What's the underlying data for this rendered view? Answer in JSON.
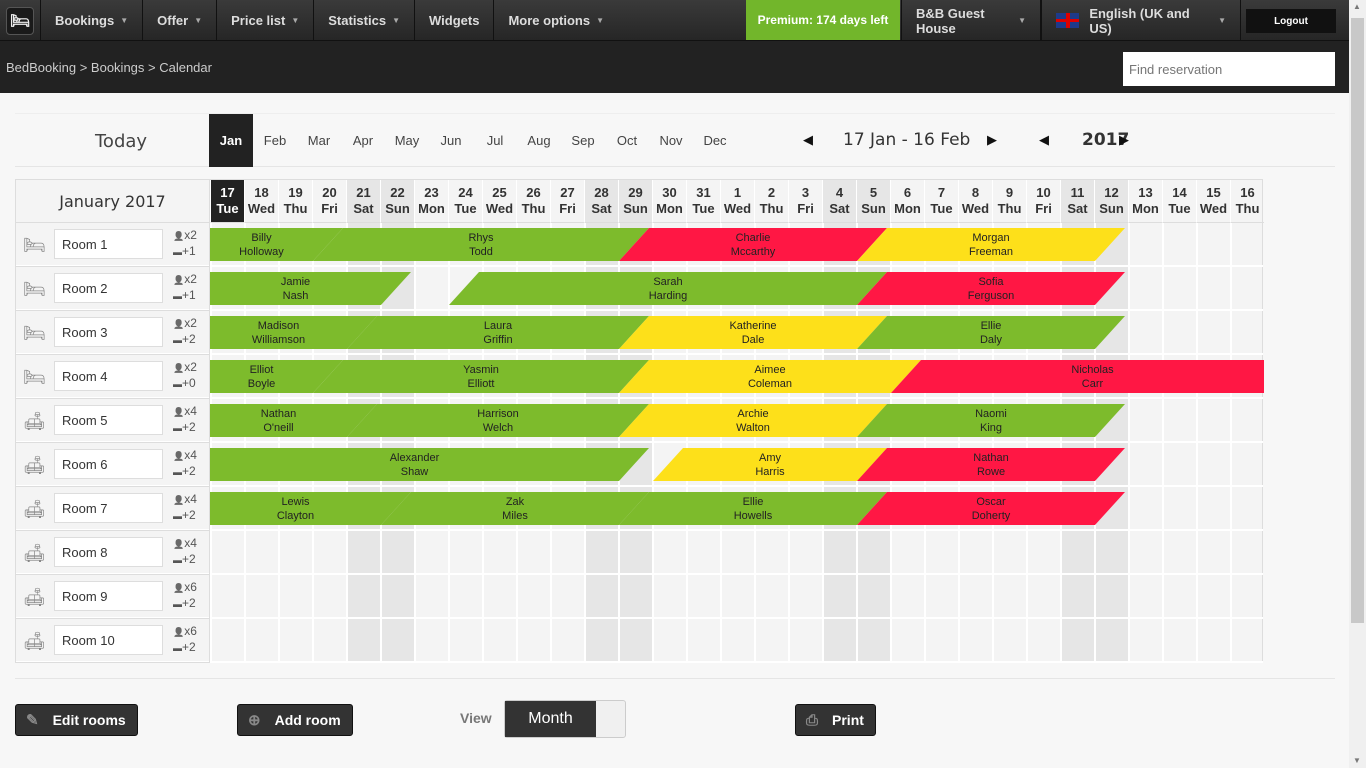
{
  "nav": {
    "items": [
      {
        "label": "Bookings",
        "dropdown": true
      },
      {
        "label": "Offer",
        "dropdown": true
      },
      {
        "label": "Price list",
        "dropdown": true
      },
      {
        "label": "Statistics",
        "dropdown": true
      },
      {
        "label": "Widgets",
        "dropdown": false
      },
      {
        "label": "More options",
        "dropdown": true
      }
    ],
    "premium": "Premium: 174 days left",
    "property": "B&B Guest House",
    "language": "English (UK and US)",
    "logout": "Logout"
  },
  "breadcrumb": "BedBooking > Bookings > Calendar",
  "search": {
    "placeholder": "Find reservation",
    "value": ""
  },
  "toolbar": {
    "today": "Today",
    "months": [
      "Jan",
      "Feb",
      "Mar",
      "Apr",
      "May",
      "Jun",
      "Jul",
      "Aug",
      "Sep",
      "Oct",
      "Nov",
      "Dec"
    ],
    "active_month": "Jan",
    "range": "17 Jan - 16 Feb",
    "year": "2017"
  },
  "calendar": {
    "title": "January 2017",
    "today_index": 0,
    "days": [
      [
        "17",
        "Tue"
      ],
      [
        "18",
        "Wed"
      ],
      [
        "19",
        "Thu"
      ],
      [
        "20",
        "Fri"
      ],
      [
        "21",
        "Sat"
      ],
      [
        "22",
        "Sun"
      ],
      [
        "23",
        "Mon"
      ],
      [
        "24",
        "Tue"
      ],
      [
        "25",
        "Wed"
      ],
      [
        "26",
        "Thu"
      ],
      [
        "27",
        "Fri"
      ],
      [
        "28",
        "Sat"
      ],
      [
        "29",
        "Sun"
      ],
      [
        "30",
        "Mon"
      ],
      [
        "31",
        "Tue"
      ],
      [
        "1",
        "Wed"
      ],
      [
        "2",
        "Thu"
      ],
      [
        "3",
        "Fri"
      ],
      [
        "4",
        "Sat"
      ],
      [
        "5",
        "Sun"
      ],
      [
        "6",
        "Mon"
      ],
      [
        "7",
        "Tue"
      ],
      [
        "8",
        "Wed"
      ],
      [
        "9",
        "Thu"
      ],
      [
        "10",
        "Fri"
      ],
      [
        "11",
        "Sat"
      ],
      [
        "12",
        "Sun"
      ],
      [
        "13",
        "Mon"
      ],
      [
        "14",
        "Tue"
      ],
      [
        "15",
        "Wed"
      ],
      [
        "16",
        "Thu"
      ]
    ],
    "colors": {
      "green": "#7dbb2c",
      "yellow": "#fde01a",
      "red": "#ff1744"
    },
    "rooms": [
      {
        "name": "Room 1",
        "icon": "single-bed",
        "guests": "x2",
        "extra": "+1",
        "bookings": [
          {
            "first": "Billy",
            "last": "Holloway",
            "in": null,
            "out": "2017-01-20",
            "color": "green"
          },
          {
            "first": "Rhys",
            "last": "Todd",
            "in": "2017-01-20",
            "out": "2017-01-29",
            "color": "green"
          },
          {
            "first": "Charlie",
            "last": "Mccarthy",
            "in": "2017-01-29",
            "out": "2017-02-05",
            "color": "red"
          },
          {
            "first": "Morgan",
            "last": "Freeman",
            "in": "2017-02-05",
            "out": "2017-02-12",
            "color": "yellow"
          }
        ]
      },
      {
        "name": "Room 2",
        "icon": "single-bed",
        "guests": "x2",
        "extra": "+1",
        "bookings": [
          {
            "first": "Jamie",
            "last": "Nash",
            "in": null,
            "out": "2017-01-22",
            "color": "green"
          },
          {
            "first": "Sarah",
            "last": "Harding",
            "in": "2017-01-24",
            "out": "2017-02-05",
            "color": "green"
          },
          {
            "first": "Sofia",
            "last": "Ferguson",
            "in": "2017-02-05",
            "out": "2017-02-12",
            "color": "red"
          }
        ]
      },
      {
        "name": "Room 3",
        "icon": "single-bed",
        "guests": "x2",
        "extra": "+2",
        "bookings": [
          {
            "first": "Madison",
            "last": "Williamson",
            "in": null,
            "out": "2017-01-21",
            "color": "green"
          },
          {
            "first": "Laura",
            "last": "Griffin",
            "in": "2017-01-21",
            "out": "2017-01-29",
            "color": "green"
          },
          {
            "first": "Katherine",
            "last": "Dale",
            "in": "2017-01-29",
            "out": "2017-02-05",
            "color": "yellow"
          },
          {
            "first": "Ellie",
            "last": "Daly",
            "in": "2017-02-05",
            "out": "2017-02-12",
            "color": "green"
          }
        ]
      },
      {
        "name": "Room 4",
        "icon": "single-bed",
        "guests": "x2",
        "extra": "+0",
        "bookings": [
          {
            "first": "Elliot",
            "last": "Boyle",
            "in": null,
            "out": "2017-01-20",
            "color": "green"
          },
          {
            "first": "Yasmin",
            "last": "Elliott",
            "in": "2017-01-20",
            "out": "2017-01-29",
            "color": "green"
          },
          {
            "first": "Aimee",
            "last": "Coleman",
            "in": "2017-01-29",
            "out": "2017-02-06",
            "color": "yellow"
          },
          {
            "first": "Nicholas",
            "last": "Carr",
            "in": "2017-02-06",
            "out": null,
            "color": "red"
          }
        ]
      },
      {
        "name": "Room 5",
        "icon": "double-bed",
        "guests": "x4",
        "extra": "+2",
        "bookings": [
          {
            "first": "Nathan",
            "last": "O'neill",
            "in": null,
            "out": "2017-01-21",
            "color": "green"
          },
          {
            "first": "Harrison",
            "last": "Welch",
            "in": "2017-01-21",
            "out": "2017-01-29",
            "color": "green"
          },
          {
            "first": "Archie",
            "last": "Walton",
            "in": "2017-01-29",
            "out": "2017-02-05",
            "color": "yellow"
          },
          {
            "first": "Naomi",
            "last": "King",
            "in": "2017-02-05",
            "out": "2017-02-12",
            "color": "green"
          }
        ]
      },
      {
        "name": "Room 6",
        "icon": "double-bed",
        "guests": "x4",
        "extra": "+2",
        "bookings": [
          {
            "first": "Alexander",
            "last": "Shaw",
            "in": null,
            "out": "2017-01-29",
            "color": "green"
          },
          {
            "first": "Amy",
            "last": "Harris",
            "in": "2017-01-30",
            "out": "2017-02-05",
            "color": "yellow"
          },
          {
            "first": "Nathan",
            "last": "Rowe",
            "in": "2017-02-05",
            "out": "2017-02-12",
            "color": "red"
          }
        ]
      },
      {
        "name": "Room 7",
        "icon": "double-bed",
        "guests": "x4",
        "extra": "+2",
        "bookings": [
          {
            "first": "Lewis",
            "last": "Clayton",
            "in": null,
            "out": "2017-01-22",
            "color": "green"
          },
          {
            "first": "Zak",
            "last": "Miles",
            "in": "2017-01-22",
            "out": "2017-01-29",
            "color": "green"
          },
          {
            "first": "Ellie",
            "last": "Howells",
            "in": "2017-01-29",
            "out": "2017-02-05",
            "color": "green"
          },
          {
            "first": "Oscar",
            "last": "Doherty",
            "in": "2017-02-05",
            "out": "2017-02-12",
            "color": "red"
          }
        ]
      },
      {
        "name": "Room 8",
        "icon": "double-bed",
        "guests": "x4",
        "extra": "+2",
        "bookings": []
      },
      {
        "name": "Room 9",
        "icon": "double-bed",
        "guests": "x6",
        "extra": "+2",
        "bookings": []
      },
      {
        "name": "Room 10",
        "icon": "double-bed",
        "guests": "x6",
        "extra": "+2",
        "bookings": []
      }
    ]
  },
  "footer": {
    "edit_rooms": "Edit rooms",
    "add_room": "Add room",
    "view_label": "View",
    "view_value": "Month",
    "print": "Print"
  }
}
